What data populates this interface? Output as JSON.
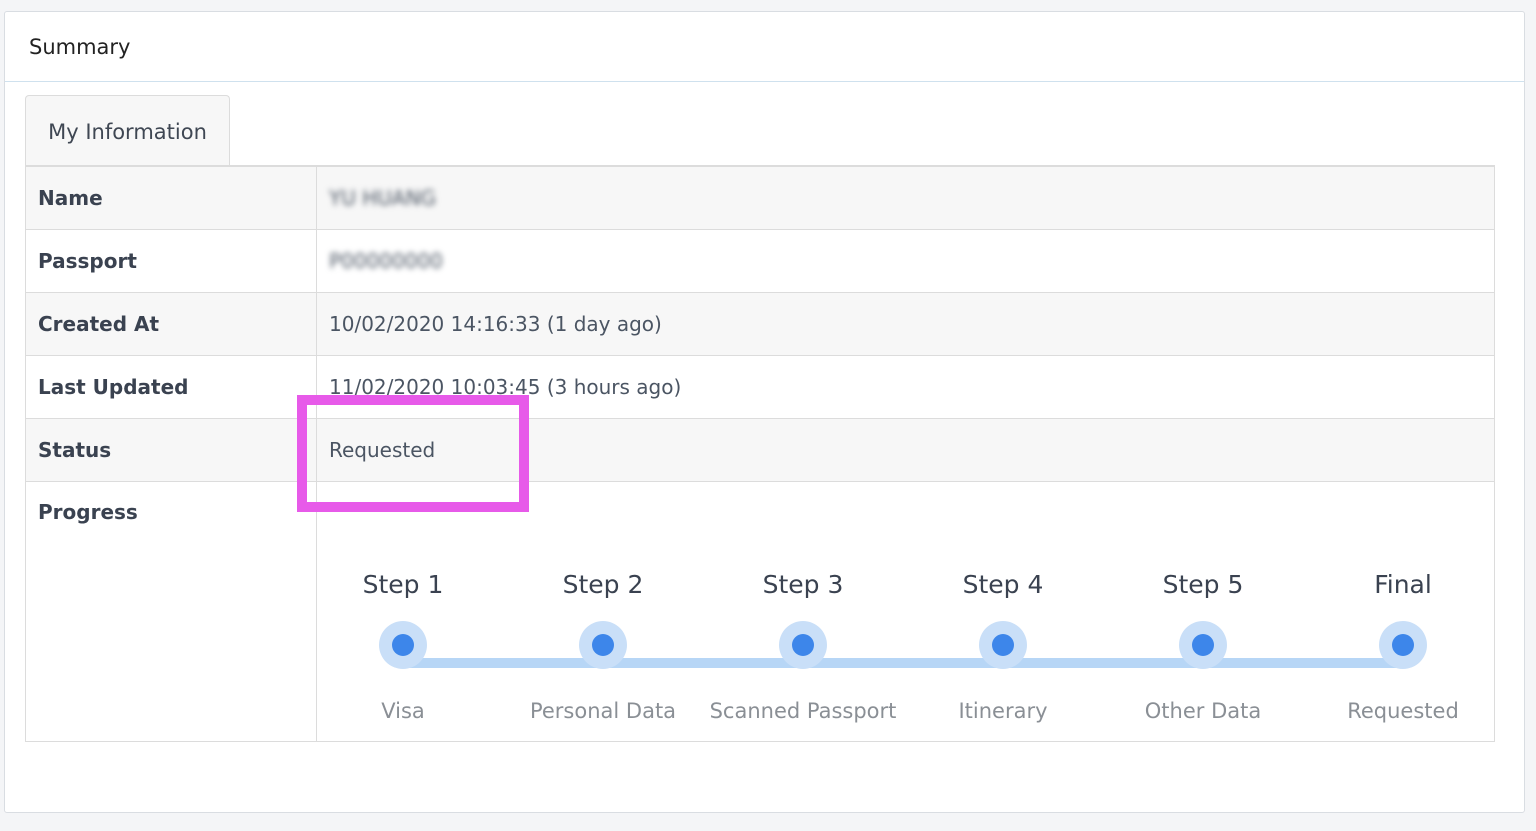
{
  "panel": {
    "title": "Summary"
  },
  "tab": {
    "label": "My Information"
  },
  "rows": [
    {
      "label": "Name",
      "value": "YU HUANG"
    },
    {
      "label": "Passport",
      "value": "P00000000"
    },
    {
      "label": "Created At",
      "value": "10/02/2020 14:16:33 (1 day ago)"
    },
    {
      "label": "Last Updated",
      "value": "11/02/2020 10:03:45 (3 hours ago)"
    },
    {
      "label": "Status",
      "value": "Requested"
    },
    {
      "label": "Progress"
    }
  ],
  "steps": [
    {
      "title": "Step 1",
      "subtitle": "Visa"
    },
    {
      "title": "Step 2",
      "subtitle": "Personal Data"
    },
    {
      "title": "Step 3",
      "subtitle": "Scanned Passport"
    },
    {
      "title": "Step 4",
      "subtitle": "Itinerary"
    },
    {
      "title": "Step 5",
      "subtitle": "Other Data"
    },
    {
      "title": "Final",
      "subtitle": "Requested"
    }
  ],
  "colors": {
    "accent": "#3d86ea",
    "track": "#b7d6f6",
    "highlight": "#e75ae9"
  }
}
